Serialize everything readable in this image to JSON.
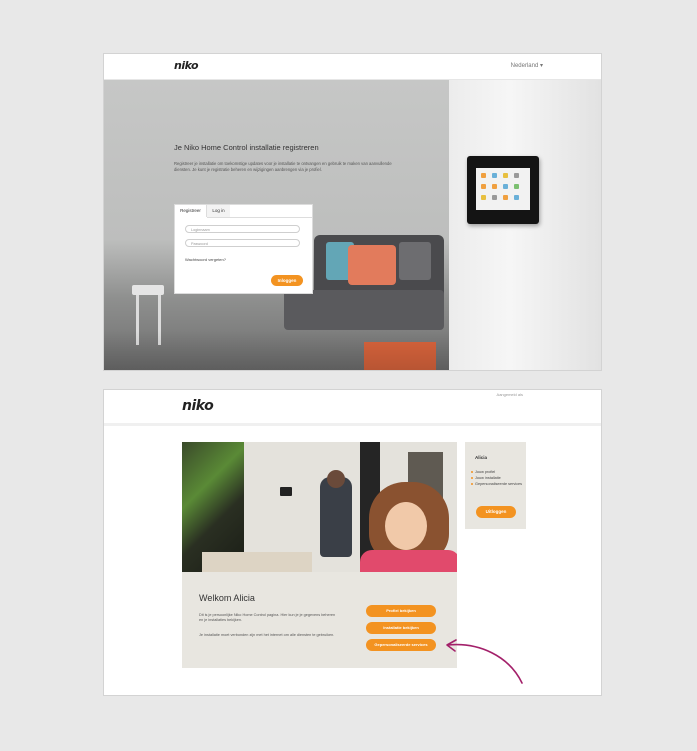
{
  "screen1": {
    "logo": "niko",
    "language": "Nederland",
    "heading": "Je Niko Home Control installatie registreren",
    "description": "Registreer je installatie om toekomstige updates voor je installatie te ontvangen en gebruik te maken van aanvullende diensten. Je kunt je registratie beheren en wijzigingen aanbrengen via je profiel.",
    "login": {
      "tab_register": "Registreer",
      "tab_login": "Log in",
      "username_placeholder": "Loginnaam",
      "password_placeholder": "Paswoord",
      "forgot_password": "Wachtwoord vergeten?",
      "submit": "Inloggen"
    }
  },
  "screen2": {
    "logo": "niko",
    "account_text": "Aangemeld als",
    "welcome_title": "Welkom Alicia",
    "welcome_text_1": "Dit is je persoonlijke Niko Home Control pagina. Hier kun je je gegevens beheren en je installaties bekijken.",
    "welcome_text_2": "Je installatie moet verbonden zijn met het internet om alle diensten te gebruiken.",
    "buttons": {
      "profile": "Profiel bekijken",
      "installation": "Installatie bekijken",
      "services": "Gepersonaliseerde services"
    },
    "sidebar": {
      "name": "Alicia",
      "items": [
        "Jouw profiel",
        "Jouw installatie",
        "Gepersonaliseerde services"
      ],
      "logout": "Uitloggen"
    }
  },
  "colors": {
    "accent": "#f39321",
    "arrow": "#a3206a",
    "background": "#e8e8e8"
  }
}
